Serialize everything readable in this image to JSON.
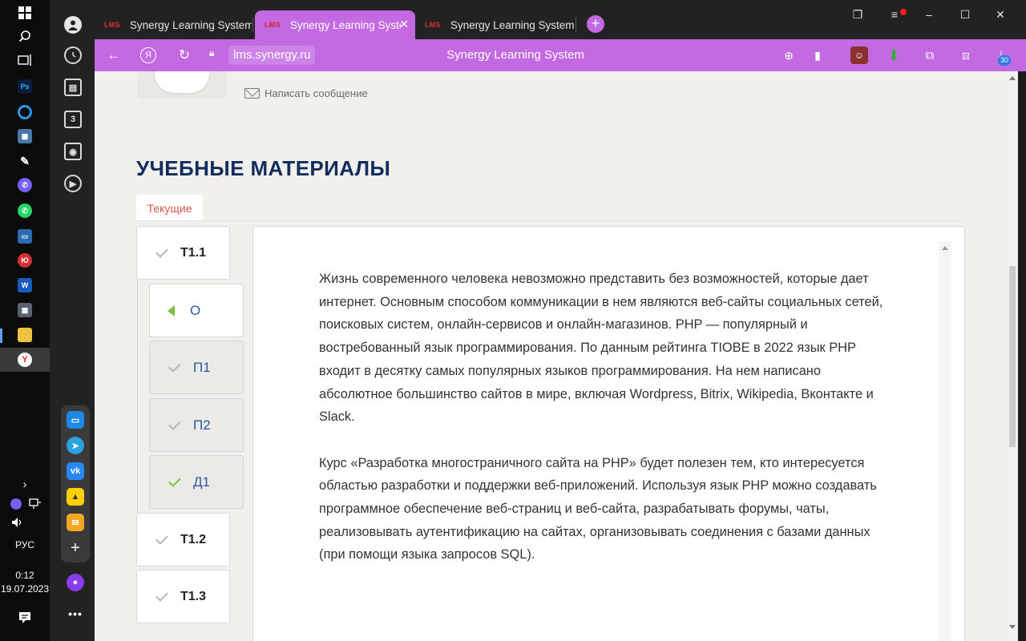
{
  "taskbar": {
    "language": "РУС",
    "time": "0:12",
    "date": "19.07.2023",
    "icons": [
      "windows-start-icon",
      "search-icon",
      "task-view-icon",
      "photoshop-icon",
      "browser-icon",
      "network-app-icon",
      "pen-app-icon",
      "viber-icon",
      "whatsapp-icon",
      "monitor-app-icon",
      "yu-app-icon",
      "word-icon",
      "calculator-icon",
      "file-explorer-icon",
      "yandex-browser-icon"
    ]
  },
  "tabs": [
    {
      "logo": "LMS",
      "title": "Synergy Learning System",
      "active": false
    },
    {
      "logo": "LMS",
      "title": "Synergy Learning System",
      "active": true
    },
    {
      "logo": "LMS",
      "title": "Synergy Learning System",
      "active": false
    }
  ],
  "address_bar": {
    "url": "lms.synergy.ru",
    "page_title": "Synergy Learning System",
    "download_count": "30"
  },
  "page": {
    "message_link": "Написать сообщение",
    "section_title": "УЧЕБНЫЕ МАТЕРИАЛЫ",
    "tab_current": "Текущие",
    "nav": {
      "t11": "Т1.1",
      "o": "О",
      "p1": "П1",
      "p2": "П2",
      "d1": "Д1",
      "t12": "Т1.2",
      "t13": "Т1.3"
    },
    "paragraphs": [
      "Жизнь современного человека невозможно представить без возможностей, которые дает интернет. Основным способом коммуникации в нем являются веб-сайты социальных сетей, поисковых систем, онлайн-сервисов и онлайн-магазинов. PHP — популярный и востребованный язык программирования. По данным рейтинга TIOBE в 2022 язык PHP входит в десятку самых популярных языков программирования. На нем написано абсолютное большинство сайтов в мире, включая Wordpress, Bitrix, Wikipedia, Вконтакте и Slack.",
      "Курс «Разработка многостраничного сайта на PHP» будет полезен тем, кто интересуется областью разработки и поддержки веб-приложений. Используя язык PHP можно создавать программное обеспечение веб-страниц и веб-сайта, разрабатывать форумы, чаты, реализовывать аутентификацию на сайтах, организовывать соединения с базами данных (при помощи языка запросов SQL)."
    ]
  },
  "colors": {
    "accent": "#c36ae2",
    "title": "#122c5b",
    "tab_text": "#d9534f",
    "check_done": "#7cc142",
    "sub_label": "#2b5a9c"
  }
}
